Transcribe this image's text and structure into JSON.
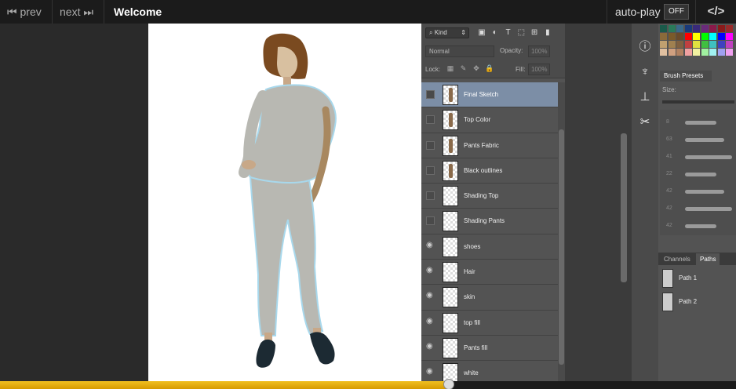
{
  "nav": {
    "prev_label": "prev",
    "next_label": "next",
    "title": "Welcome",
    "autoplay_label": "auto-play",
    "autoplay_state": "OFF",
    "code_label": "</>"
  },
  "layers_panel": {
    "kind_label": "Kind",
    "blend_mode": "Normal",
    "opacity_label": "Opacity:",
    "opacity_value": "100%",
    "lock_label": "Lock:",
    "fill_label": "Fill:",
    "fill_value": "100%",
    "layers": [
      {
        "name": "Final Sketch",
        "visible": false,
        "selected": true
      },
      {
        "name": "Top Color",
        "visible": false,
        "selected": false
      },
      {
        "name": "Pants Fabric",
        "visible": false,
        "selected": false
      },
      {
        "name": "Black outlines",
        "visible": false,
        "selected": false
      },
      {
        "name": "Shading Top",
        "visible": false,
        "selected": false
      },
      {
        "name": "Shading Pants",
        "visible": false,
        "selected": false
      },
      {
        "name": "shoes",
        "visible": true,
        "selected": false
      },
      {
        "name": "Hair",
        "visible": true,
        "selected": false
      },
      {
        "name": "skin",
        "visible": true,
        "selected": false
      },
      {
        "name": "top fill",
        "visible": true,
        "selected": false
      },
      {
        "name": "Pants fill",
        "visible": true,
        "selected": false
      },
      {
        "name": "white",
        "visible": true,
        "selected": false
      }
    ]
  },
  "right_panel": {
    "brush_presets_label": "Brush Presets",
    "size_label": "Size:",
    "brush_sizes": [
      "8",
      "63",
      "41",
      "22",
      "42",
      "42",
      "42"
    ],
    "channels_tab": "Channels",
    "paths_tab": "Paths",
    "paths": [
      {
        "name": "Path 1"
      },
      {
        "name": "Path 2"
      }
    ]
  },
  "progress": {
    "played": 0.61
  },
  "colors": {
    "accent": "#e8b010",
    "selected_layer": "#7c8ea6",
    "panel_bg": "#535353"
  }
}
